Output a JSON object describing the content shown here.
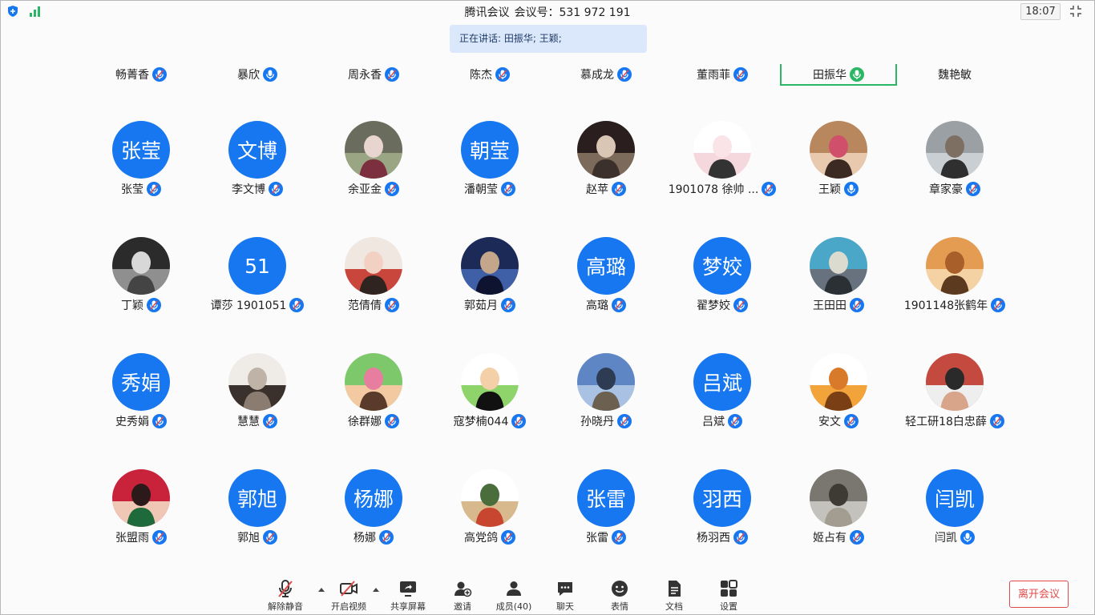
{
  "titlebar": {
    "app_name": "腾讯会议",
    "meeting_id_label": "会议号：531 972 191",
    "clock": "18:07"
  },
  "speaking_banner": "正在讲话: 田振华; 王颖;",
  "strip": [
    {
      "name": "畅菁香",
      "mic": "muted"
    },
    {
      "name": "暴欣",
      "mic": "on"
    },
    {
      "name": "周永香",
      "mic": "muted"
    },
    {
      "name": "陈杰",
      "mic": "muted"
    },
    {
      "name": "慕成龙",
      "mic": "muted"
    },
    {
      "name": "董雨菲",
      "mic": "muted"
    },
    {
      "name": "田振华",
      "mic": "speaking",
      "active": true
    },
    {
      "name": "魏艳敏",
      "mic": "none"
    }
  ],
  "participants": [
    {
      "name": "张莹",
      "avatar_text": "张莹",
      "mic": "muted"
    },
    {
      "name": "李文博",
      "avatar_text": "文博",
      "mic": "muted"
    },
    {
      "name": "余亚金",
      "avatar_text": "",
      "mic": "muted",
      "photo": "p1"
    },
    {
      "name": "潘朝莹",
      "avatar_text": "朝莹",
      "mic": "muted"
    },
    {
      "name": "赵苹",
      "avatar_text": "",
      "mic": "muted",
      "photo": "p2"
    },
    {
      "name": "1901078 徐帅 ...",
      "avatar_text": "",
      "mic": "muted",
      "photo": "p3"
    },
    {
      "name": "王颖",
      "avatar_text": "",
      "mic": "on",
      "photo": "p4"
    },
    {
      "name": "章家豪",
      "avatar_text": "",
      "mic": "muted",
      "photo": "p5"
    },
    {
      "name": "丁颖",
      "avatar_text": "",
      "mic": "muted",
      "photo": "p6"
    },
    {
      "name": "谭莎 1901051",
      "avatar_text": "51",
      "mic": "muted"
    },
    {
      "name": "范倩倩",
      "avatar_text": "",
      "mic": "muted",
      "photo": "p7"
    },
    {
      "name": "郭茹月",
      "avatar_text": "",
      "mic": "muted",
      "photo": "p8"
    },
    {
      "name": "高璐",
      "avatar_text": "高璐",
      "mic": "muted"
    },
    {
      "name": "翟梦姣",
      "avatar_text": "梦姣",
      "mic": "muted"
    },
    {
      "name": "王田田",
      "avatar_text": "",
      "mic": "muted",
      "photo": "p9"
    },
    {
      "name": "1901148张鹤年",
      "avatar_text": "",
      "mic": "muted",
      "photo": "p10"
    },
    {
      "name": "史秀娟",
      "avatar_text": "秀娟",
      "mic": "muted"
    },
    {
      "name": "慧慧",
      "avatar_text": "",
      "mic": "muted",
      "photo": "p11"
    },
    {
      "name": "徐群娜",
      "avatar_text": "",
      "mic": "muted",
      "photo": "p12"
    },
    {
      "name": "寇梦楠044",
      "avatar_text": "",
      "mic": "muted",
      "photo": "p13"
    },
    {
      "name": "孙晓丹",
      "avatar_text": "",
      "mic": "muted",
      "photo": "p14"
    },
    {
      "name": "吕斌",
      "avatar_text": "吕斌",
      "mic": "muted"
    },
    {
      "name": "安文",
      "avatar_text": "",
      "mic": "muted",
      "photo": "p15"
    },
    {
      "name": "轻工研18白忠薛",
      "avatar_text": "",
      "mic": "muted",
      "photo": "p16"
    },
    {
      "name": "张盟雨",
      "avatar_text": "",
      "mic": "muted",
      "photo": "p17"
    },
    {
      "name": "郭旭",
      "avatar_text": "郭旭",
      "mic": "muted"
    },
    {
      "name": "杨娜",
      "avatar_text": "杨娜",
      "mic": "muted"
    },
    {
      "name": "高党鸽",
      "avatar_text": "",
      "mic": "muted",
      "photo": "p18"
    },
    {
      "name": "张雷",
      "avatar_text": "张雷",
      "mic": "muted"
    },
    {
      "name": "杨羽西",
      "avatar_text": "羽西",
      "mic": "muted"
    },
    {
      "name": "姬占有",
      "avatar_text": "",
      "mic": "muted",
      "photo": "p19"
    },
    {
      "name": "闫凯",
      "avatar_text": "闫凯",
      "mic": "on"
    }
  ],
  "toolbar": {
    "unmute": "解除静音",
    "start_video": "开启视频",
    "share_screen": "共享屏幕",
    "invite": "邀请",
    "members": "成员(40)",
    "chat": "聊天",
    "reactions": "表情",
    "docs": "文档",
    "settings": "设置",
    "leave": "离开会议"
  },
  "colors": {
    "accent_blue": "#1677f0",
    "speaking_green": "#29b766",
    "leave_red": "#e24a4a",
    "banner_bg": "#dbe8fb"
  },
  "icons": [
    "shield-icon",
    "signal-icon",
    "fullscreen-icon",
    "mic-icon",
    "mic-muted-icon",
    "video-off-icon",
    "share-screen-icon",
    "invite-icon",
    "members-icon",
    "chat-icon",
    "emoji-icon",
    "docs-icon",
    "settings-icon"
  ]
}
